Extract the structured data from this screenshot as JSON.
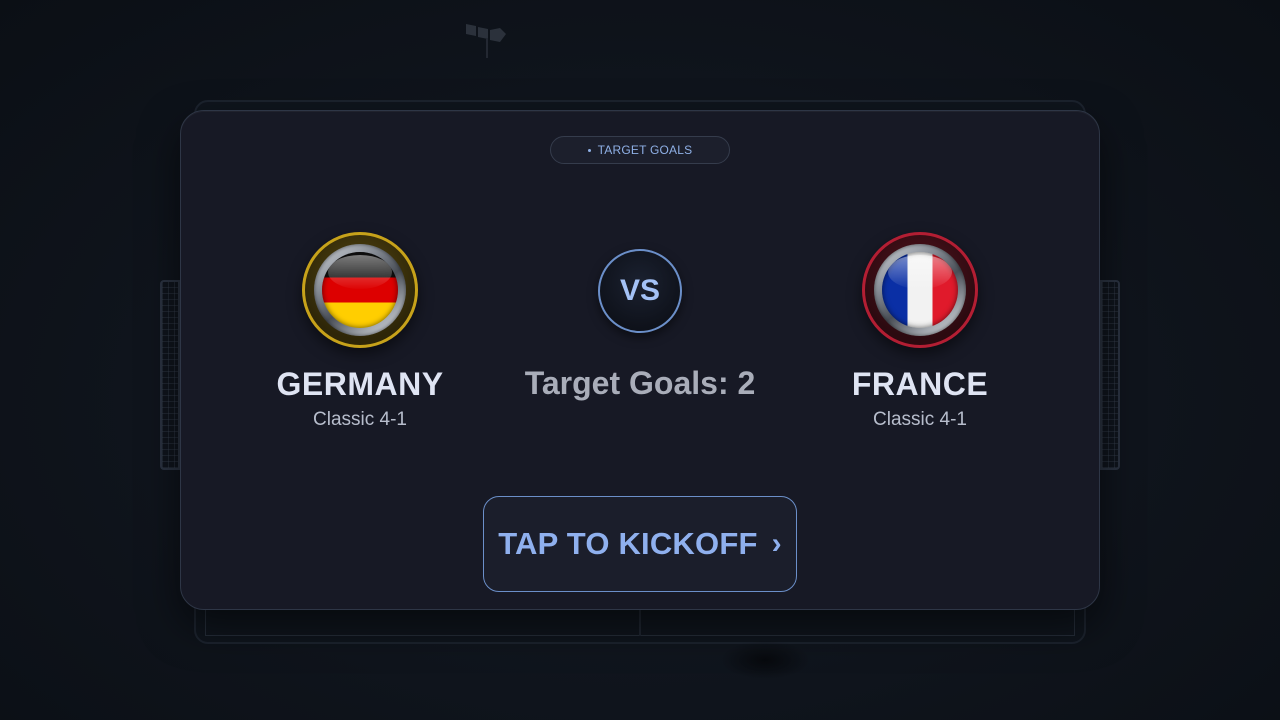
{
  "pill": {
    "label": "TARGET GOALS"
  },
  "home_team": {
    "name": "GERMANY",
    "formation": "Classic 4-1",
    "flag": "germany-flag",
    "accent": "#c7a21a"
  },
  "away_team": {
    "name": "FRANCE",
    "formation": "Classic 4-1",
    "flag": "france-flag",
    "accent": "#b31e33"
  },
  "vs": {
    "label": "VS"
  },
  "target": {
    "label": "Target Goals: 2",
    "value": 2
  },
  "kickoff": {
    "label": "TAP TO KICKOFF",
    "icon": "chevron-right-icon",
    "chevron": "›"
  },
  "colors": {
    "accent": "#8fb0ee",
    "card_bg": "#171925",
    "page_bg": "#0e131b"
  }
}
